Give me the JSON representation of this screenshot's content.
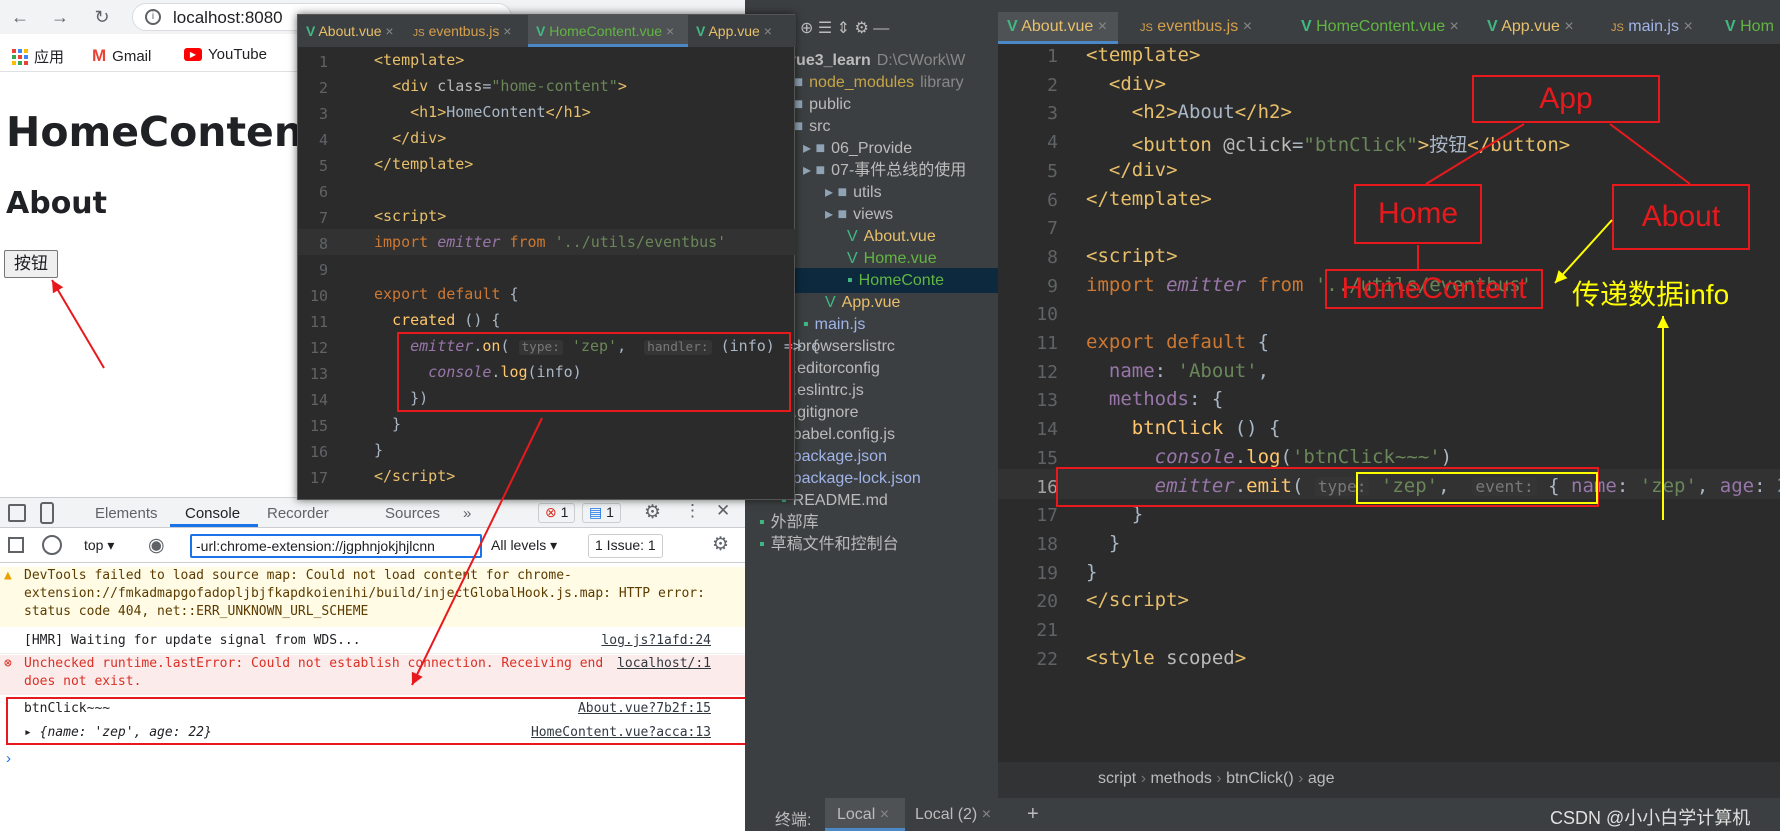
{
  "browser": {
    "url": "localhost:8080",
    "bookmarks": [
      "应用",
      "Gmail",
      "YouTube"
    ],
    "page": {
      "h1": "HomeContent",
      "h2": "About",
      "button": "按钮"
    }
  },
  "devtools": {
    "tabs": [
      "Elements",
      "Console",
      "Recorder",
      "Sources"
    ],
    "error_count": "1",
    "warn_count": "1",
    "context": "top",
    "filter": "-url:chrome-extension://jgphnjokjhjlcnn",
    "levels": "All levels",
    "issues": "1 Issue: 1",
    "messages": [
      {
        "text": "DevTools failed to load source map: Could not load content for chrome-extension://fmkadmapgofadopljbjfkapdkoienihi/build/injectGlobalHook.js.map: HTTP error: status code 404, net::ERR_UNKNOWN_URL_SCHEME",
        "src": ""
      },
      {
        "text": "[HMR] Waiting for update signal from WDS...",
        "src": "log.js?1afd:24"
      },
      {
        "text": "Unchecked runtime.lastError: Could not establish connection. Receiving end does not exist.",
        "src": "localhost/:1"
      },
      {
        "text": "btnClick~~~",
        "src": "About.vue?7b2f:15"
      },
      {
        "text": "▸ {name: 'zep', age: 22}",
        "src": "HomeContent.vue?acca:13"
      }
    ]
  },
  "popup": {
    "tabs": [
      "About.vue",
      "eventbus.js",
      "HomeContent.vue",
      "App.vue"
    ],
    "lines": [
      "1",
      "2",
      "3",
      "4",
      "5",
      "6",
      "7",
      "8",
      "9",
      "10",
      "11",
      "12",
      "13",
      "14",
      "15",
      "16",
      "17"
    ]
  },
  "ide": {
    "tabs": [
      "About.vue",
      "eventbus.js",
      "HomeContent.vue",
      "App.vue",
      "main.js",
      "Hom"
    ],
    "tree": [
      {
        "label": "vue3_learn",
        "extra": "D:\\CWork\\W",
        "indent": 0
      },
      {
        "label": "node_modules",
        "extra": "library",
        "indent": 1
      },
      {
        "label": "public",
        "extra": "",
        "indent": 1
      },
      {
        "label": "src",
        "extra": "",
        "indent": 1
      },
      {
        "label": "06_Provide",
        "extra": "",
        "indent": 2
      },
      {
        "label": "07-事件总线的使用",
        "extra": "",
        "indent": 2
      },
      {
        "label": "utils",
        "extra": "",
        "indent": 3
      },
      {
        "label": "views",
        "extra": "",
        "indent": 3
      },
      {
        "label": "About.vue",
        "extra": "",
        "indent": 4
      },
      {
        "label": "Home.vue",
        "extra": "",
        "indent": 4
      },
      {
        "label": "HomeConte",
        "extra": "",
        "indent": 4
      },
      {
        "label": "App.vue",
        "extra": "",
        "indent": 3
      },
      {
        "label": "main.js",
        "extra": "",
        "indent": 2
      },
      {
        "label": ".browserslistrc",
        "extra": "",
        "indent": 1
      },
      {
        "label": ".editorconfig",
        "extra": "",
        "indent": 1
      },
      {
        "label": ".eslintrc.js",
        "extra": "",
        "indent": 1
      },
      {
        "label": ".gitignore",
        "extra": "",
        "indent": 1
      },
      {
        "label": "babel.config.js",
        "extra": "",
        "indent": 1
      },
      {
        "label": "package.json",
        "extra": "",
        "indent": 1
      },
      {
        "label": "package-lock.json",
        "extra": "",
        "indent": 1
      },
      {
        "label": "README.md",
        "extra": "",
        "indent": 1
      },
      {
        "label": "外部库",
        "extra": "",
        "indent": 0
      },
      {
        "label": "草稿文件和控制台",
        "extra": "",
        "indent": 0
      }
    ],
    "line_numbers": [
      "1",
      "2",
      "3",
      "4",
      "5",
      "6",
      "7",
      "8",
      "9",
      "10",
      "11",
      "12",
      "13",
      "14",
      "15",
      "16",
      "17",
      "18",
      "19",
      "20",
      "21",
      "22"
    ],
    "breadcrumb": [
      "script",
      "methods",
      "btnClick()",
      "age"
    ],
    "terminal": {
      "label": "终端:",
      "tabs": [
        "Local",
        "Local (2)"
      ]
    },
    "watermark": "CSDN @小小白学计算机"
  },
  "diagram": {
    "app": "App",
    "home": "Home",
    "about": "About",
    "homecontent": "HomeContent",
    "caption": "传递数据info"
  },
  "colors": {
    "annotation_red": "#e8191d",
    "annotation_yellow": "#ffff00"
  }
}
